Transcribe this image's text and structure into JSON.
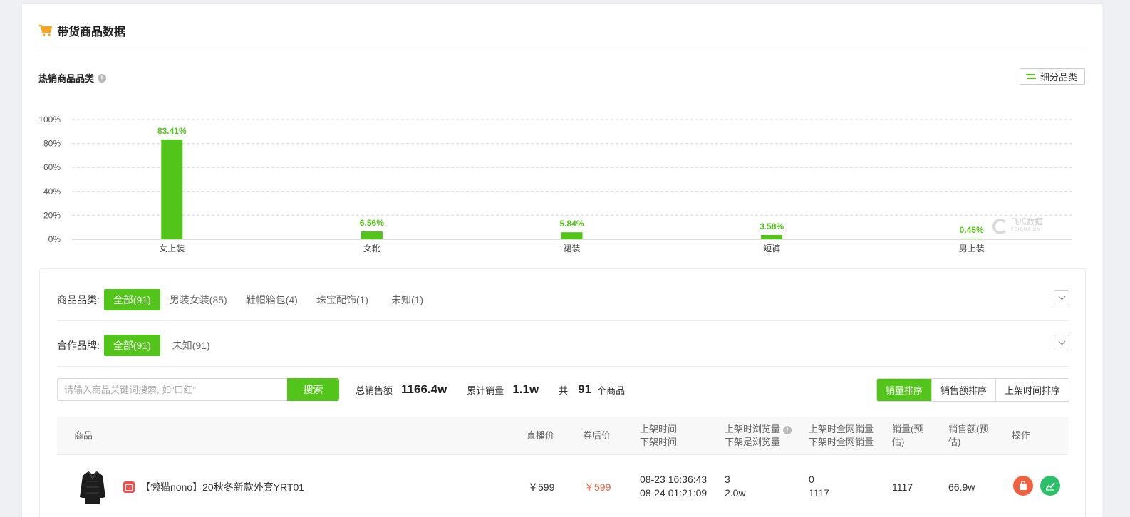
{
  "header": {
    "title": "带货商品数据",
    "icon": "cart-icon"
  },
  "section": {
    "subtitle": "热销商品品类",
    "fenlei_button": "细分品类"
  },
  "chart_data": {
    "type": "bar",
    "categories": [
      "女上装",
      "女靴",
      "裙装",
      "短裤",
      "男上装"
    ],
    "values": [
      83.41,
      6.56,
      5.84,
      3.58,
      0.45
    ],
    "value_labels": [
      "83.41%",
      "6.56%",
      "5.84%",
      "3.58%",
      "0.45%"
    ],
    "ylim": [
      0,
      100
    ],
    "yticks": [
      "0%",
      "20%",
      "40%",
      "60%",
      "80%",
      "100%"
    ],
    "grid": true,
    "bar_color": "#52c41a",
    "title": "",
    "xlabel": "",
    "ylabel": ""
  },
  "watermark": {
    "text": "飞瓜数据",
    "tag": "抖音版",
    "sub": "FEIGUA.CN"
  },
  "filters": {
    "category": {
      "label": "商品品类:",
      "options": [
        "全部(91)",
        "男装女装(85)",
        "鞋帽箱包(4)",
        "珠宝配饰(1)",
        "未知(1)"
      ],
      "active": 0
    },
    "brand": {
      "label": "合作品牌:",
      "options": [
        "全部(91)",
        "未知(91)"
      ],
      "active": 0
    }
  },
  "search": {
    "placeholder": "请输入商品关键词搜索, 如“口红”",
    "button": "搜索"
  },
  "stats": {
    "total_sales_label": "总销售额",
    "total_sales": "1166.4w",
    "cum_volume_label": "累计销量",
    "cum_volume": "1.1w",
    "count_prefix": "共",
    "count": "91",
    "count_suffix": "个商品"
  },
  "sort": {
    "options": [
      "销量排序",
      "销售额排序",
      "上架时间排序"
    ],
    "active": 0
  },
  "table": {
    "headers": {
      "product": "商品",
      "live_price": "直播价",
      "coupon_price": "券后价",
      "time_on": "上架时间",
      "time_off": "下架时间",
      "view_on": "上架时浏览量",
      "view_off": "下架是浏览量",
      "net_on": "上架时全网销量",
      "net_off": "下架时全网销量",
      "volume_1": "销量(预",
      "volume_2": "估)",
      "sales_1": "销售额(预",
      "sales_2": "估)",
      "ops": "操作"
    },
    "rows": [
      {
        "name": "【懒猫nono】20秋冬新款外套YRT01",
        "live_price": "￥599",
        "coupon_price": "￥599",
        "time_on": "08-23 16:36:43",
        "time_off": "08-24 01:21:09",
        "view_on": "3",
        "view_off": "2.0w",
        "net_on": "0",
        "net_off": "1117",
        "volume": "1117",
        "sales": "66.9w"
      }
    ]
  },
  "colors": {
    "accent": "#52c41a",
    "coupon": "#f2613f",
    "action_red": "#f2613f",
    "action_green": "#2bbf6a"
  }
}
